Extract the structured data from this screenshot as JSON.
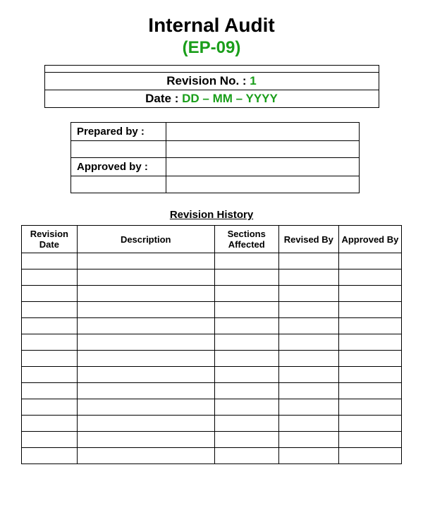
{
  "header": {
    "title": "Internal Audit",
    "code": "(EP-09)",
    "revision_label": "Revision No. : ",
    "revision_value": "1",
    "date_label": "Date : ",
    "date_value": "DD – MM – YYYY"
  },
  "signoff": {
    "prepared_label": "Prepared by :",
    "prepared_value": "",
    "approved_label": "Approved by :",
    "approved_value": ""
  },
  "history": {
    "title": "Revision History",
    "columns": {
      "date": "Revision Date",
      "description": "Description",
      "sections": "Sections Affected",
      "revised": "Revised By",
      "approved": "Approved By"
    },
    "row_count": 13
  }
}
